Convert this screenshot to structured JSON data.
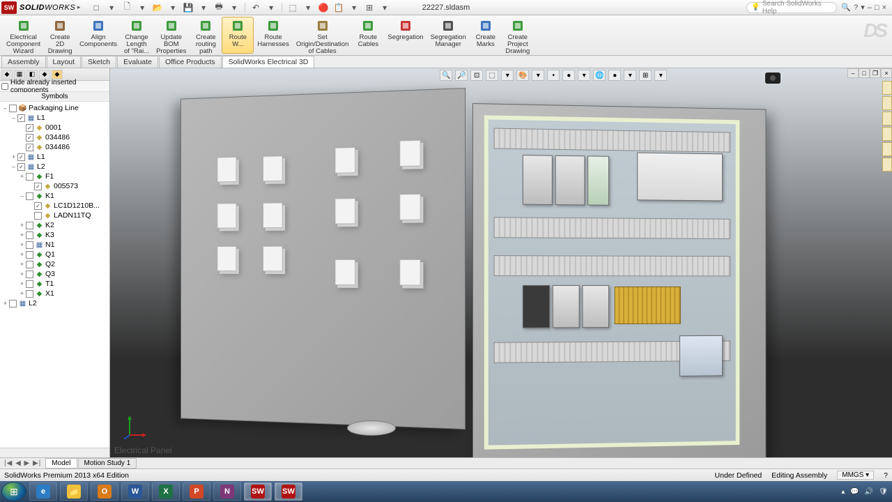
{
  "titlebar": {
    "logo": "SW",
    "brand_bold": "SOLID",
    "brand_light": "WORKS",
    "document": "22227.sldasm",
    "search_placeholder": "Search SolidWorks Help"
  },
  "qat": [
    "□",
    "▾",
    "🗋",
    "▾",
    "📂",
    "▾",
    "💾",
    "▾",
    "🖶",
    "▾",
    "|",
    "↶",
    "▾",
    "|",
    "⬚",
    "▾",
    "🔴",
    "📋",
    "▾",
    "⊞",
    "▾"
  ],
  "title_right_icons": [
    "🔍",
    "?",
    "▾",
    "–",
    "□",
    "×"
  ],
  "ribbon": [
    {
      "label": "Electrical\nComponent\nWizard",
      "color": "#1d8a1d"
    },
    {
      "label": "Create\n2D\nDrawing",
      "color": "#7d4c1d"
    },
    {
      "label": "Align\nComponents",
      "color": "#1d5ab0"
    },
    {
      "label": "Change\nLength\nof \"Rai...",
      "color": "#1d8a1d"
    },
    {
      "label": "Update\nBOM\nProperties",
      "color": "#1d8a1d"
    },
    {
      "label": "Create\nrouting\npath",
      "color": "#1d8a1d"
    },
    {
      "label": "Route\nW...",
      "color": "#1d8a1d",
      "active": true
    },
    {
      "label": "Route\nHarnesses",
      "color": "#1d8a1d"
    },
    {
      "label": "Set\nOrigin/Destination\nof Cables",
      "color": "#8a6a1d"
    },
    {
      "label": "Route\nCables",
      "color": "#1d8a1d"
    },
    {
      "label": "Segregation",
      "color": "#c01414"
    },
    {
      "label": "Segregation\nManager",
      "color": "#333"
    },
    {
      "label": "Create\nMarks",
      "color": "#1d5ab0"
    },
    {
      "label": "Create\nProject\nDrawing",
      "color": "#1d8a1d"
    }
  ],
  "tabs": [
    "Assembly",
    "Layout",
    "Sketch",
    "Evaluate",
    "Office Products",
    "SolidWorks Electrical 3D"
  ],
  "active_tab_index": 5,
  "side": {
    "hide_check": "Hide already inserted components",
    "header": "Symbols"
  },
  "tree": [
    {
      "ind": 0,
      "tw": "–",
      "ck": false,
      "ico": "📦",
      "icocol": "#c4a93e",
      "label": "Packaging Line"
    },
    {
      "ind": 1,
      "tw": "–",
      "ck": true,
      "ico": "▦",
      "icocol": "#42699d",
      "label": "L1"
    },
    {
      "ind": 2,
      "tw": "",
      "ck": true,
      "ico": "◆",
      "icocol": "#c4a93e",
      "label": "0001"
    },
    {
      "ind": 2,
      "tw": "",
      "ck": true,
      "ico": "◆",
      "icocol": "#c4a93e",
      "label": "034486"
    },
    {
      "ind": 2,
      "tw": "",
      "ck": true,
      "ico": "◆",
      "icocol": "#c4a93e",
      "label": "034486"
    },
    {
      "ind": 1,
      "tw": "+",
      "ck": true,
      "ico": "▦",
      "icocol": "#42699d",
      "label": "L1"
    },
    {
      "ind": 1,
      "tw": "–",
      "ck": true,
      "ico": "▦",
      "icocol": "#42699d",
      "label": "L2"
    },
    {
      "ind": 2,
      "tw": "+",
      "ck": false,
      "ico": "◆",
      "icocol": "#2f8f2f",
      "label": "F1"
    },
    {
      "ind": 3,
      "tw": "",
      "ck": true,
      "ico": "◆",
      "icocol": "#c4a93e",
      "label": "005573"
    },
    {
      "ind": 2,
      "tw": "–",
      "ck": false,
      "ico": "◆",
      "icocol": "#2f8f2f",
      "label": "K1"
    },
    {
      "ind": 3,
      "tw": "",
      "ck": true,
      "ico": "◆",
      "icocol": "#c4a93e",
      "label": "LC1D1210B..."
    },
    {
      "ind": 3,
      "tw": "",
      "ck": false,
      "ico": "◆",
      "icocol": "#c4a93e",
      "label": "LADN11TQ"
    },
    {
      "ind": 2,
      "tw": "+",
      "ck": false,
      "ico": "◆",
      "icocol": "#2f8f2f",
      "label": "K2"
    },
    {
      "ind": 2,
      "tw": "+",
      "ck": false,
      "ico": "◆",
      "icocol": "#2f8f2f",
      "label": "K3"
    },
    {
      "ind": 2,
      "tw": "+",
      "ck": false,
      "ico": "▦",
      "icocol": "#42699d",
      "label": "N1"
    },
    {
      "ind": 2,
      "tw": "+",
      "ck": false,
      "ico": "◆",
      "icocol": "#2f8f2f",
      "label": "Q1"
    },
    {
      "ind": 2,
      "tw": "+",
      "ck": false,
      "ico": "◆",
      "icocol": "#2f8f2f",
      "label": "Q2"
    },
    {
      "ind": 2,
      "tw": "+",
      "ck": false,
      "ico": "◆",
      "icocol": "#2f8f2f",
      "label": "Q3"
    },
    {
      "ind": 2,
      "tw": "+",
      "ck": false,
      "ico": "◆",
      "icocol": "#2f8f2f",
      "label": "T1"
    },
    {
      "ind": 2,
      "tw": "+",
      "ck": false,
      "ico": "◆",
      "icocol": "#2f8f2f",
      "label": "X1"
    },
    {
      "ind": 0,
      "tw": "+",
      "ck": false,
      "ico": "▦",
      "icocol": "#42699d",
      "label": "L2"
    }
  ],
  "vp_tools": [
    "🔍",
    "🔎",
    "⊡",
    "⬚",
    "▾",
    "🎨",
    "▾",
    "•",
    "●",
    "▾",
    "🌐",
    "●",
    "▾",
    "⊞",
    "▾"
  ],
  "vp_caption": "Electrical Panel",
  "model_tabs": {
    "nav": "|◀ ◀ ▶ ▶|",
    "tabs": [
      "Model",
      "Motion Study 1"
    ],
    "active": 0
  },
  "status": {
    "left": "SolidWorks Premium 2013 x64 Edition",
    "defined": "Under Defined",
    "mode": "Editing Assembly",
    "units": "MMGS",
    "q": "?"
  },
  "taskbar_apps": [
    {
      "bg": "#2b7cc4",
      "txt": "e"
    },
    {
      "bg": "#f0c23b",
      "txt": "📁"
    },
    {
      "bg": "#d97b18",
      "txt": "O"
    },
    {
      "bg": "#2b5797",
      "txt": "W"
    },
    {
      "bg": "#1e7145",
      "txt": "X"
    },
    {
      "bg": "#d24726",
      "txt": "P"
    },
    {
      "bg": "#7e3878",
      "txt": "N"
    },
    {
      "bg": "#b01313",
      "txt": "SW",
      "active": true
    },
    {
      "bg": "#b01313",
      "txt": "SW",
      "active": true
    }
  ],
  "tray_icons": [
    "▴",
    "💬",
    "🔊",
    "🛡"
  ]
}
